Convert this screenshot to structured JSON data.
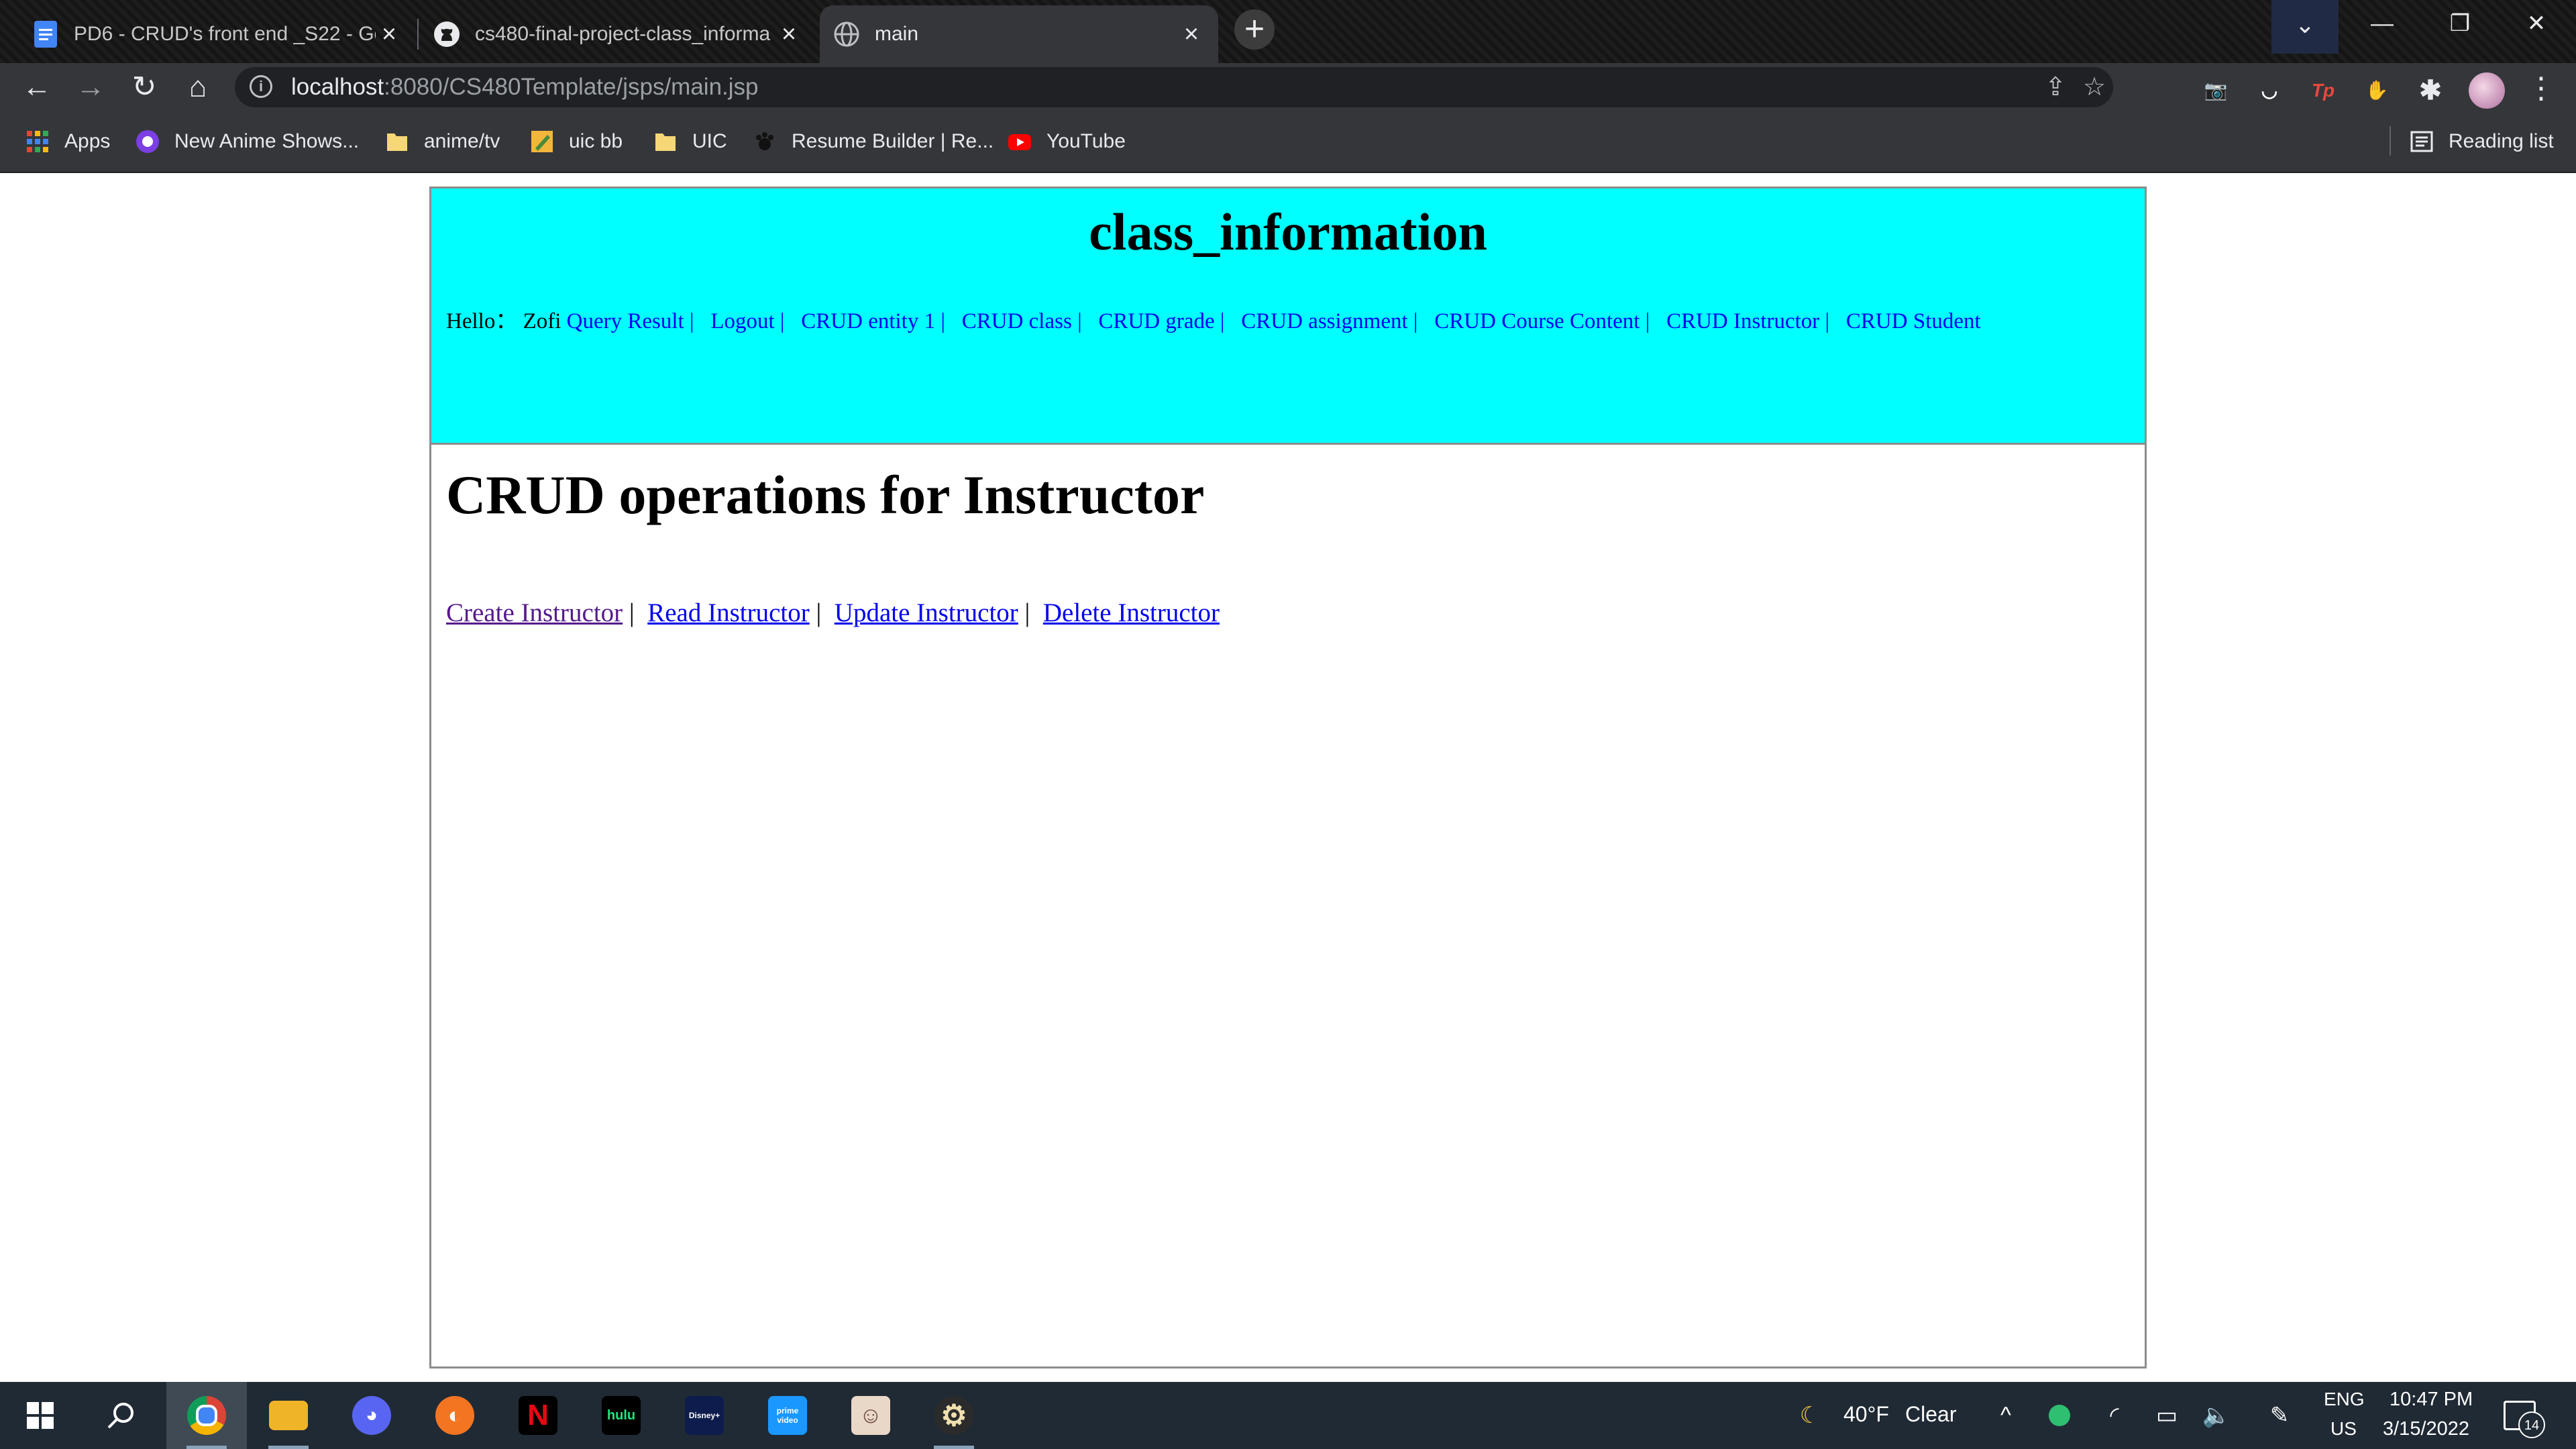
{
  "browser": {
    "tabs": [
      {
        "title": "PD6 - CRUD's front end _S22 - Go",
        "icon": "google-docs-icon",
        "active": false
      },
      {
        "title": "cs480-final-project-class_informa",
        "icon": "github-icon",
        "active": false
      },
      {
        "title": "main",
        "icon": "globe-icon",
        "active": true
      }
    ],
    "new_tab_label": "+",
    "url_host": "localhost",
    "url_path": ":8080/CS480Template/jsps/main.jsp",
    "bookmarks": [
      {
        "label": "Apps",
        "icon": "apps-grid-icon"
      },
      {
        "label": "New Anime Shows...",
        "icon": "purple-circle-icon"
      },
      {
        "label": "anime/tv",
        "icon": "folder-icon"
      },
      {
        "label": "uic bb",
        "icon": "pencil-icon"
      },
      {
        "label": "UIC",
        "icon": "folder-icon"
      },
      {
        "label": "Resume Builder | Re...",
        "icon": "paw-icon"
      },
      {
        "label": "YouTube",
        "icon": "youtube-icon"
      }
    ],
    "reading_list_label": "Reading list",
    "extensions": [
      {
        "name": "camera-extension-icon",
        "text": "📷",
        "color": "#4a6fb5"
      },
      {
        "name": "pocket-extension-icon",
        "text": "◡",
        "color": "#d6303d"
      },
      {
        "name": "tp-extension-icon",
        "text": "Tp",
        "color": "#35363a"
      },
      {
        "name": "hand-extension-icon",
        "text": "✋",
        "color": "#e01e2d"
      },
      {
        "name": "puzzle-extensions-icon",
        "text": "✱",
        "color": "#35363a"
      }
    ]
  },
  "page": {
    "site_title": "class_information",
    "greeting": "Hello：",
    "user_name": "Zofi",
    "nav_links": [
      "Query Result",
      "Logout",
      "CRUD entity 1",
      "CRUD class",
      "CRUD grade",
      "CRUD assignment",
      "CRUD Course Content",
      "CRUD Instructor",
      "CRUD Student"
    ],
    "heading": "CRUD operations for Instructor",
    "crud_links": [
      "Create Instructor",
      "Read Instructor",
      "Update Instructor",
      "Delete Instructor"
    ],
    "separator": "|"
  },
  "taskbar": {
    "apps": [
      {
        "name": "chrome-taskbar-icon",
        "text": "◉",
        "color": "#db4437"
      },
      {
        "name": "file-explorer-taskbar-icon",
        "text": "▬",
        "color": "#f0b429"
      },
      {
        "name": "discord-taskbar-icon",
        "text": "◕",
        "color": "#5865f2"
      },
      {
        "name": "crunchyroll-taskbar-icon",
        "text": "◐",
        "color": "#f47521"
      },
      {
        "name": "netflix-taskbar-icon",
        "text": "N",
        "color": "#000000"
      },
      {
        "name": "hulu-taskbar-icon",
        "text": "hulu",
        "color": "#000000"
      },
      {
        "name": "disney-plus-taskbar-icon",
        "text": "Disney+",
        "color": "#0d1c4d"
      },
      {
        "name": "prime-video-taskbar-icon",
        "text": "prime video",
        "color": "#1a98ff"
      },
      {
        "name": "anime-app-taskbar-icon",
        "text": "☺",
        "color": "#e9d8c8"
      },
      {
        "name": "settings-gear-taskbar-icon",
        "text": "⚙",
        "color": "#2b2b2b"
      }
    ],
    "weather_temp": "40°F",
    "weather_desc": "Clear",
    "lang_top": "ENG",
    "lang_bottom": "US",
    "time": "10:47 PM",
    "date": "3/15/2022",
    "notification_count": "14"
  }
}
